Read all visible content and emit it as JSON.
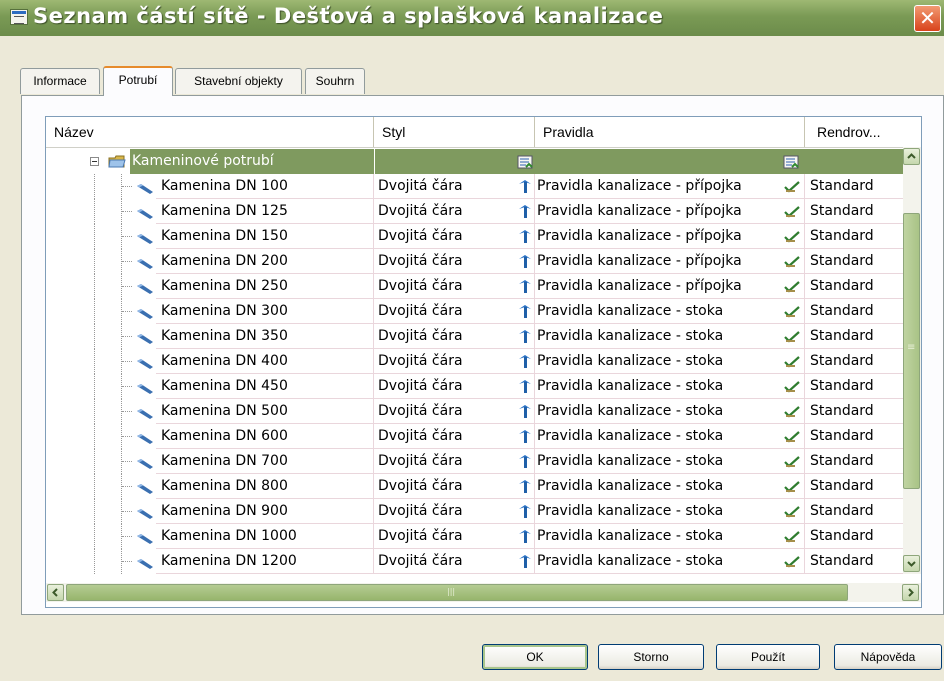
{
  "window": {
    "title": "Seznam částí sítě - Dešťová a splašková kanalizace",
    "close_label": "✕"
  },
  "tabs": [
    "Informace",
    "Potrubí",
    "Stavební objekty",
    "Souhrn"
  ],
  "active_tab": "Potrubí",
  "columns": {
    "name": "Název",
    "style": "Styl",
    "rules": "Pravidla",
    "render": "Rendrov..."
  },
  "group": {
    "label": "Kameninové potrubí",
    "expanded": true
  },
  "rows": [
    {
      "name": "Kamenina DN 100",
      "style": "Dvojitá čára",
      "rules": "Pravidla kanalizace - přípojka",
      "render": "Standard"
    },
    {
      "name": "Kamenina DN 125",
      "style": "Dvojitá čára",
      "rules": "Pravidla kanalizace - přípojka",
      "render": "Standard"
    },
    {
      "name": "Kamenina DN 150",
      "style": "Dvojitá čára",
      "rules": "Pravidla kanalizace - přípojka",
      "render": "Standard"
    },
    {
      "name": "Kamenina DN 200",
      "style": "Dvojitá čára",
      "rules": "Pravidla kanalizace - přípojka",
      "render": "Standard"
    },
    {
      "name": "Kamenina DN 250",
      "style": "Dvojitá čára",
      "rules": "Pravidla kanalizace - přípojka",
      "render": "Standard"
    },
    {
      "name": "Kamenina DN 300",
      "style": "Dvojitá čára",
      "rules": "Pravidla kanalizace - stoka",
      "render": "Standard"
    },
    {
      "name": "Kamenina DN 350",
      "style": "Dvojitá čára",
      "rules": "Pravidla kanalizace - stoka",
      "render": "Standard"
    },
    {
      "name": "Kamenina DN 400",
      "style": "Dvojitá čára",
      "rules": "Pravidla kanalizace - stoka",
      "render": "Standard"
    },
    {
      "name": "Kamenina DN 450",
      "style": "Dvojitá čára",
      "rules": "Pravidla kanalizace - stoka",
      "render": "Standard"
    },
    {
      "name": "Kamenina DN 500",
      "style": "Dvojitá čára",
      "rules": "Pravidla kanalizace - stoka",
      "render": "Standard"
    },
    {
      "name": "Kamenina DN 600",
      "style": "Dvojitá čára",
      "rules": "Pravidla kanalizace - stoka",
      "render": "Standard"
    },
    {
      "name": "Kamenina DN 700",
      "style": "Dvojitá čára",
      "rules": "Pravidla kanalizace - stoka",
      "render": "Standard"
    },
    {
      "name": "Kamenina DN 800",
      "style": "Dvojitá čára",
      "rules": "Pravidla kanalizace - stoka",
      "render": "Standard"
    },
    {
      "name": "Kamenina DN 900",
      "style": "Dvojitá čára",
      "rules": "Pravidla kanalizace - stoka",
      "render": "Standard"
    },
    {
      "name": "Kamenina DN 1000",
      "style": "Dvojitá čára",
      "rules": "Pravidla kanalizace - stoka",
      "render": "Standard"
    },
    {
      "name": "Kamenina DN 1200",
      "style": "Dvojitá čára",
      "rules": "Pravidla kanalizace - stoka",
      "render": "Standard"
    }
  ],
  "scroll": {
    "grip": "≡",
    "hgrip": "|||"
  },
  "buttons": {
    "ok": "OK",
    "cancel": "Storno",
    "apply": "Použít",
    "help": "Nápověda"
  },
  "colors": {
    "title_bar": "#7a9a55",
    "group_row": "#7f9a5f",
    "close": "#d9431c",
    "tab_accent": "#e68b2c",
    "row_grid": "#ead6dc"
  },
  "icons": {
    "window": "dialog-icon",
    "close": "close-icon",
    "expand": "minus-box-icon",
    "folder": "folder-icon",
    "pipe": "pipe-icon",
    "style_edit": "style-edit-icon",
    "rules_edit": "check-edit-icon",
    "group_edit": "edit-list-icon"
  }
}
